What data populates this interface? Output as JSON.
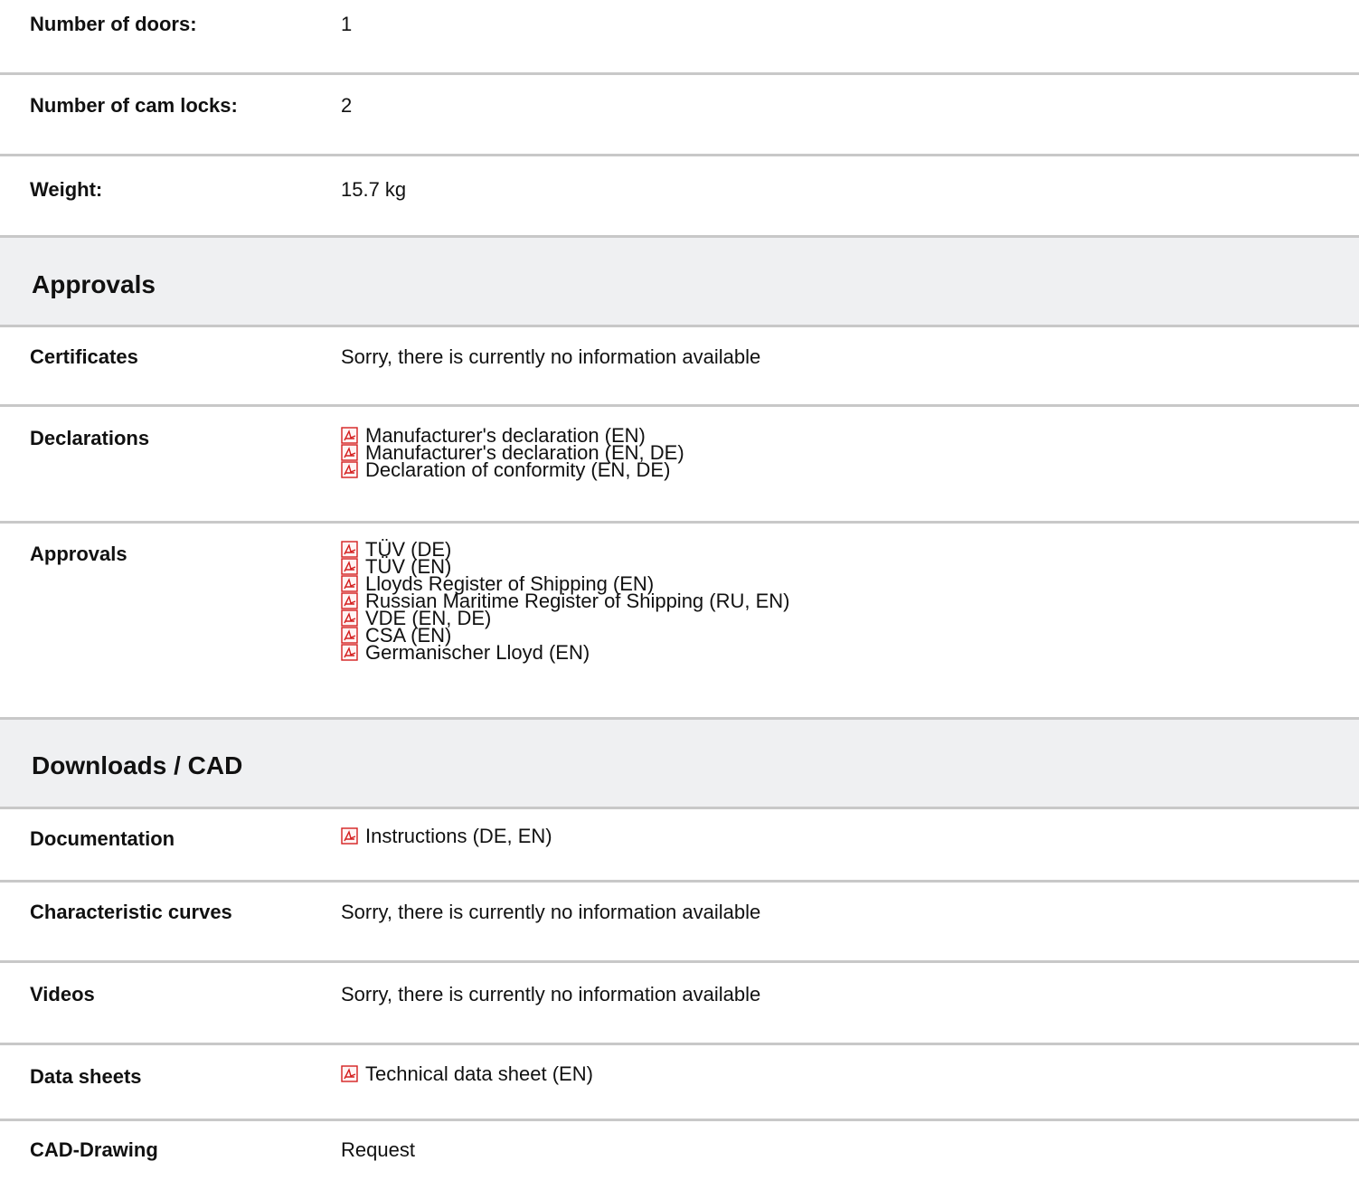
{
  "specs": [
    {
      "label": "Number of doors:",
      "value": "1"
    },
    {
      "label": "Number of cam locks:",
      "value": "2"
    },
    {
      "label": "Weight:",
      "value": "15.7 kg"
    }
  ],
  "approvals_section": {
    "title": "Approvals",
    "certificates": {
      "label": "Certificates",
      "value": "Sorry, there is currently no information available"
    },
    "declarations": {
      "label": "Declarations",
      "items": [
        "Manufacturer's declaration (EN)",
        "Manufacturer's declaration (EN, DE)",
        "Declaration of conformity (EN, DE)"
      ]
    },
    "approvals": {
      "label": "Approvals",
      "items": [
        "TÜV (DE)",
        "TÜV (EN)",
        "Lloyds Register of Shipping (EN)",
        "Russian Maritime Register of Shipping (RU, EN)",
        "VDE (EN, DE)",
        "CSA (EN)",
        "Germanischer Lloyd (EN)"
      ]
    }
  },
  "downloads_section": {
    "title": "Downloads / CAD",
    "documentation": {
      "label": "Documentation",
      "items": [
        "Instructions (DE, EN)"
      ]
    },
    "characteristic_curves": {
      "label": "Characteristic curves",
      "value": "Sorry, there is currently no information available"
    },
    "videos": {
      "label": "Videos",
      "value": "Sorry, there is currently no information available"
    },
    "data_sheets": {
      "label": "Data sheets",
      "items": [
        "Technical data sheet (EN)"
      ]
    },
    "cad_drawing": {
      "label": "CAD-Drawing",
      "value": "Request"
    }
  },
  "icon": {
    "name": "pdf-file-icon",
    "color": "#d42020"
  },
  "colors": {
    "divider": "#c8c8c8",
    "section_background": "#eff0f2",
    "text": "#111111"
  }
}
